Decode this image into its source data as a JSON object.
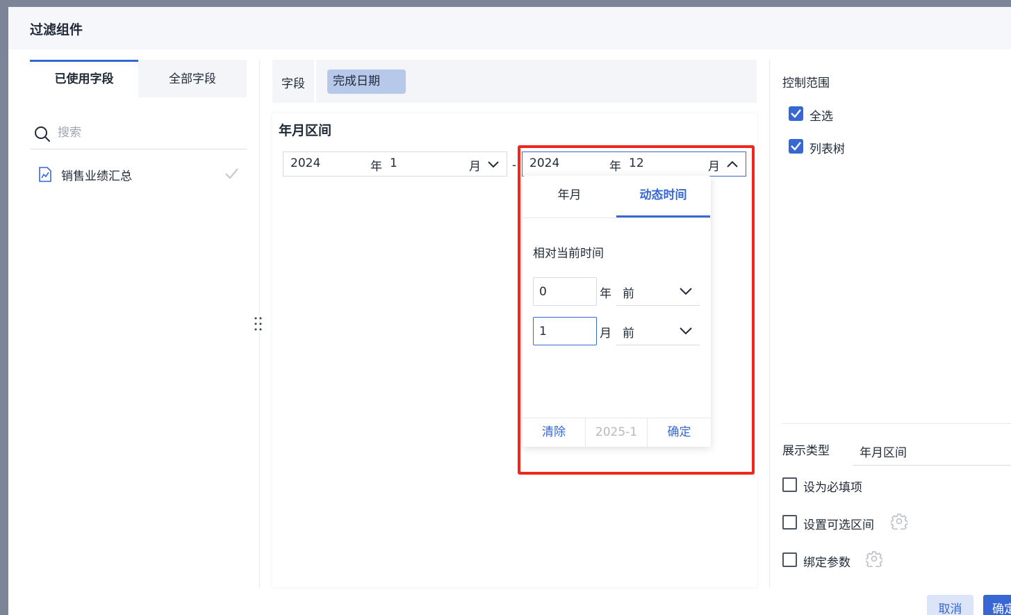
{
  "dialog": {
    "title": "过滤组件"
  },
  "left": {
    "tabs": [
      {
        "label": "已使用字段"
      },
      {
        "label": "全部字段"
      }
    ],
    "search": {
      "placeholder": "搜索"
    },
    "datasets": [
      {
        "label": "销售业绩汇总",
        "icon": "line-chart-icon",
        "checked": true
      }
    ]
  },
  "middle": {
    "field_label": "字段",
    "field_value": "完成日期",
    "preview_title": "年月区间",
    "start": {
      "year": "2024",
      "year_unit": "年",
      "month": "1",
      "month_unit": "月"
    },
    "range_sep": "-",
    "end": {
      "year": "2024",
      "year_unit": "年",
      "month": "12",
      "month_unit": "月"
    }
  },
  "dropdown": {
    "tabs": [
      {
        "label": "年月"
      },
      {
        "label": "动态时间"
      }
    ],
    "active_tab": "动态时间",
    "section_title": "相对当前时间",
    "rows": [
      {
        "value": "0",
        "unit": "年",
        "direction": "前"
      },
      {
        "value": "1",
        "unit": "月",
        "direction": "前"
      }
    ],
    "footer": {
      "clear": "清除",
      "preview": "2025-1",
      "ok": "确定"
    }
  },
  "right": {
    "scope_title": "控制范围",
    "scope_options": [
      {
        "label": "全选",
        "checked": true
      },
      {
        "label": "列表树",
        "checked": true
      }
    ],
    "display_type_label": "展示类型",
    "display_type_value": "年月区间",
    "options": [
      {
        "label": "设为必填项",
        "checked": false
      },
      {
        "label": "设置可选区间",
        "checked": false,
        "has_settings": true
      },
      {
        "label": "绑定参数",
        "checked": false,
        "has_settings": true
      }
    ]
  },
  "footer": {
    "cancel": "取消",
    "confirm": "确定"
  },
  "colors": {
    "accent": "#3767d3",
    "highlight": "#f0271c",
    "chip": "#b7c9ea"
  }
}
